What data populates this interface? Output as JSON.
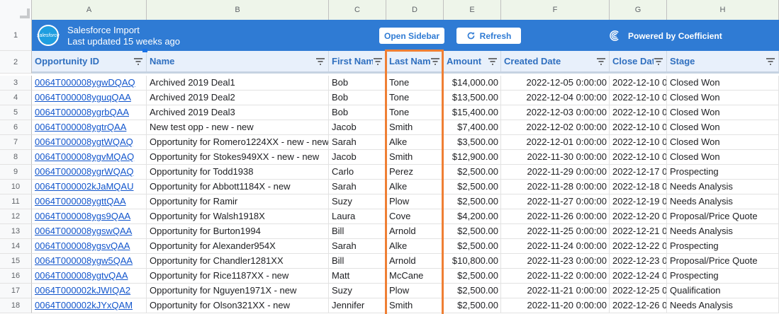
{
  "columns": [
    "A",
    "B",
    "C",
    "D",
    "E",
    "F",
    "G",
    "H"
  ],
  "row_numbers": [
    "1",
    "2",
    "3",
    "4",
    "5",
    "6",
    "7",
    "8",
    "9",
    "10",
    "11",
    "12",
    "13",
    "14",
    "15",
    "16",
    "17",
    "18"
  ],
  "banner": {
    "logo_text": "salesforce",
    "title": "Salesforce Import",
    "subtitle": "Last updated 15 weeks ago",
    "open_sidebar": "Open Sidebar",
    "refresh": "Refresh",
    "powered_by": "Powered by Coefficient",
    "color": "#2f7bd4"
  },
  "headers": [
    "Opportunity ID",
    "Name",
    "First Nam",
    "Last Nam",
    "Amount",
    "Created Date",
    "Close Dat",
    "Stage"
  ],
  "rows": [
    [
      "0064T000008ygwDQAQ",
      "Archived 2019 Deal1",
      "Bob",
      "Tone",
      "$14,000.00",
      "2022-12-05 0:00:00",
      "2022-12-10 0",
      "Closed Won"
    ],
    [
      "0064T000008yguqQAA",
      "Archived 2019 Deal2",
      "Bob",
      "Tone",
      "$13,500.00",
      "2022-12-04 0:00:00",
      "2022-12-10 0",
      "Closed Won"
    ],
    [
      "0064T000008ygrbQAA",
      "Archived 2019 Deal3",
      "Bob",
      "Tone",
      "$15,400.00",
      "2022-12-03 0:00:00",
      "2022-12-10 0",
      "Closed Won"
    ],
    [
      "0064T000008ygtrQAA",
      "New test opp - new - new",
      "Jacob",
      "Smith",
      "$7,400.00",
      "2022-12-02 0:00:00",
      "2022-12-10 0",
      "Closed Won"
    ],
    [
      "0064T000008ygtWQAQ",
      "Opportunity for Romero1224XX - new - new",
      "Sarah",
      "Alke",
      "$3,500.00",
      "2022-12-01 0:00:00",
      "2022-12-10 0",
      "Closed Won"
    ],
    [
      "0064T000008ygvMQAQ",
      "Opportunity for Stokes949XX - new - new",
      "Jacob",
      "Smith",
      "$12,900.00",
      "2022-11-30 0:00:00",
      "2022-12-10 0",
      "Closed Won"
    ],
    [
      "0064T000008ygrWQAQ",
      "Opportunity for Todd1938",
      "Carlo",
      "Perez",
      "$2,500.00",
      "2022-11-29 0:00:00",
      "2022-12-17 0",
      "Prospecting"
    ],
    [
      "0064T000002kJaMQAU",
      "Opportunity for Abbott1184X - new",
      "Sarah",
      "Alke",
      "$2,500.00",
      "2022-11-28 0:00:00",
      "2022-12-18 0",
      "Needs Analysis"
    ],
    [
      "0064T000008ygttQAA",
      "Opportunity for Ramir",
      "Suzy",
      "Plow",
      "$2,500.00",
      "2022-11-27 0:00:00",
      "2022-12-19 0",
      "Needs Analysis"
    ],
    [
      "0064T000008ygs9QAA",
      "Opportunity for Walsh1918X",
      "Laura",
      "Cove",
      "$4,200.00",
      "2022-11-26 0:00:00",
      "2022-12-20 0",
      "Proposal/Price Quote"
    ],
    [
      "0064T000008ygswQAA",
      "Opportunity for Burton1994",
      "Bill",
      "Arnold",
      "$2,500.00",
      "2022-11-25 0:00:00",
      "2022-12-21 0",
      "Needs Analysis"
    ],
    [
      "0064T000008ygsvQAA",
      "Opportunity for Alexander954X",
      "Sarah",
      "Alke",
      "$2,500.00",
      "2022-11-24 0:00:00",
      "2022-12-22 0",
      "Prospecting"
    ],
    [
      "0064T000008ygw5QAA",
      "Opportunity for Chandler1281XX",
      "Bill",
      "Arnold",
      "$10,800.00",
      "2022-11-23 0:00:00",
      "2022-12-23 0",
      "Proposal/Price Quote"
    ],
    [
      "0064T000008ygtvQAA",
      "Opportunity for Rice1187XX - new",
      "Matt",
      "McCane",
      "$2,500.00",
      "2022-11-22 0:00:00",
      "2022-12-24 0",
      "Prospecting"
    ],
    [
      "0064T000002kJWIQA2",
      "Opportunity for Nguyen1971X - new",
      "Suzy",
      "Plow",
      "$2,500.00",
      "2022-11-21 0:00:00",
      "2022-12-25 0",
      "Qualification"
    ],
    [
      "0064T000002kJYxQAM",
      "Opportunity for Olson321XX - new",
      "Jennifer",
      "Smith",
      "$2,500.00",
      "2022-11-20 0:00:00",
      "2022-12-26 0",
      "Needs Analysis"
    ]
  ],
  "highlight_color": "#ef7f34"
}
